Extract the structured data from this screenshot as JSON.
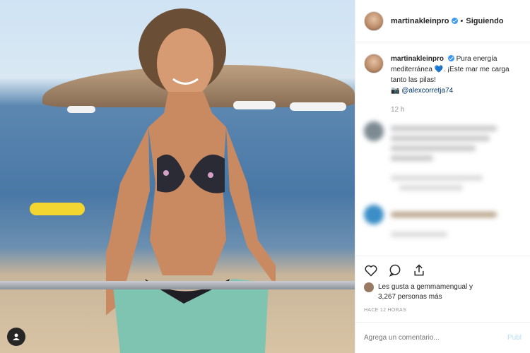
{
  "post": {
    "username": "martinakleinpro",
    "header_dot": "•",
    "follow_status": "Siguiendo",
    "caption_text": "Pura energía mediterránea",
    "caption_heart": "💙",
    "caption_rest": ". ¡Este mar me carga tanto las pilas!",
    "camera_glyph": "📷",
    "caption_mention": "@alexcorretja74",
    "time": "12 h"
  },
  "likes": {
    "line1": "Les gusta a gemmamengual y",
    "line2": "3,267 personas más"
  },
  "ago": "HACE 12 HORAS",
  "comment": {
    "placeholder": "Agrega un comentario...",
    "publish": "Publ"
  },
  "colors": {
    "verified": "#3897f0",
    "mention": "#003569"
  }
}
